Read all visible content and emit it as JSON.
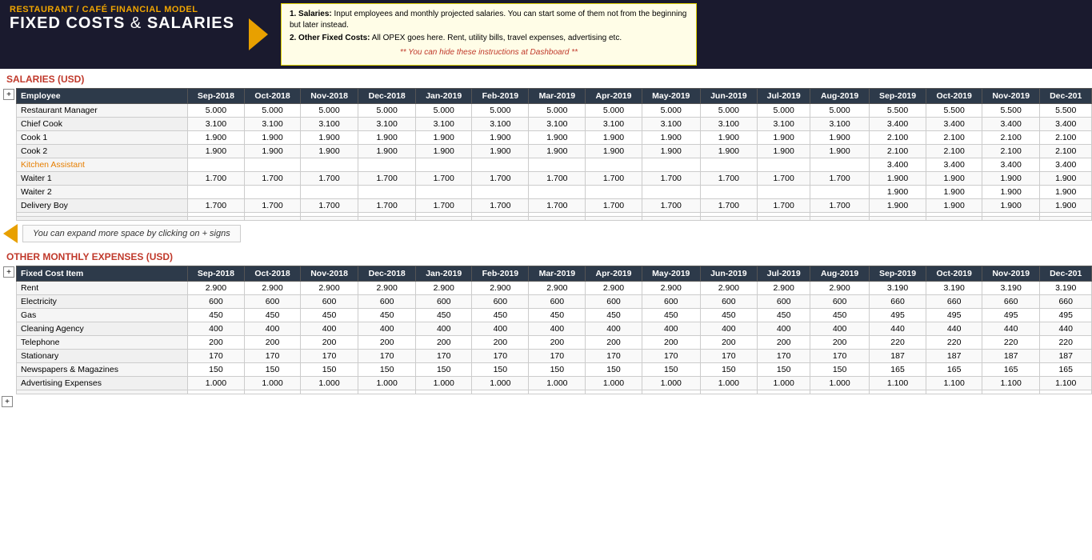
{
  "header": {
    "subtitle": "RESTAURANT / CAFÉ FINANCIAL MODEL",
    "title_main": "FIXED COSTS",
    "title_amp": " & ",
    "title_sub": "SALARIES",
    "info": {
      "point1_label": "1. Salaries:",
      "point1_text": " Input employees and monthly projected salaries. You can start some of them not from the beginning but later instead.",
      "point2_label": "2. Other Fixed Costs:",
      "point2_text": " All OPEX goes here. Rent, utility bills, travel expenses, advertising etc.",
      "note": "** You can hide these instructions at Dashboard **"
    }
  },
  "salaries_section": {
    "title": "SALARIES (USD)",
    "columns": [
      "Employee",
      "Sep-2018",
      "Oct-2018",
      "Nov-2018",
      "Dec-2018",
      "Jan-2019",
      "Feb-2019",
      "Mar-2019",
      "Apr-2019",
      "May-2019",
      "Jun-2019",
      "Jul-2019",
      "Aug-2019",
      "Sep-2019",
      "Oct-2019",
      "Nov-2019",
      "Dec-201"
    ],
    "rows": [
      {
        "name": "Restaurant Manager",
        "orange": false,
        "values": [
          "5.000",
          "5.000",
          "5.000",
          "5.000",
          "5.000",
          "5.000",
          "5.000",
          "5.000",
          "5.000",
          "5.000",
          "5.000",
          "5.000",
          "5.500",
          "5.500",
          "5.500",
          "5.500"
        ]
      },
      {
        "name": "Chief Cook",
        "orange": false,
        "values": [
          "3.100",
          "3.100",
          "3.100",
          "3.100",
          "3.100",
          "3.100",
          "3.100",
          "3.100",
          "3.100",
          "3.100",
          "3.100",
          "3.100",
          "3.400",
          "3.400",
          "3.400",
          "3.400"
        ]
      },
      {
        "name": "Cook 1",
        "orange": false,
        "values": [
          "1.900",
          "1.900",
          "1.900",
          "1.900",
          "1.900",
          "1.900",
          "1.900",
          "1.900",
          "1.900",
          "1.900",
          "1.900",
          "1.900",
          "2.100",
          "2.100",
          "2.100",
          "2.100"
        ]
      },
      {
        "name": "Cook 2",
        "orange": false,
        "values": [
          "1.900",
          "1.900",
          "1.900",
          "1.900",
          "1.900",
          "1.900",
          "1.900",
          "1.900",
          "1.900",
          "1.900",
          "1.900",
          "1.900",
          "2.100",
          "2.100",
          "2.100",
          "2.100"
        ]
      },
      {
        "name": "Kitchen Assistant",
        "orange": true,
        "values": [
          "",
          "",
          "",
          "",
          "",
          "",
          "",
          "",
          "",
          "",
          "",
          "",
          "3.400",
          "3.400",
          "3.400",
          "3.400"
        ]
      },
      {
        "name": "Waiter 1",
        "orange": false,
        "values": [
          "1.700",
          "1.700",
          "1.700",
          "1.700",
          "1.700",
          "1.700",
          "1.700",
          "1.700",
          "1.700",
          "1.700",
          "1.700",
          "1.700",
          "1.900",
          "1.900",
          "1.900",
          "1.900"
        ]
      },
      {
        "name": "Waiter 2",
        "orange": false,
        "values": [
          "",
          "",
          "",
          "",
          "",
          "",
          "",
          "",
          "",
          "",
          "",
          "",
          "1.900",
          "1.900",
          "1.900",
          "1.900"
        ]
      },
      {
        "name": "Delivery Boy",
        "orange": false,
        "values": [
          "1.700",
          "1.700",
          "1.700",
          "1.700",
          "1.700",
          "1.700",
          "1.700",
          "1.700",
          "1.700",
          "1.700",
          "1.700",
          "1.700",
          "1.900",
          "1.900",
          "1.900",
          "1.900"
        ]
      },
      {
        "name": "",
        "orange": false,
        "values": [
          "",
          "",
          "",
          "",
          "",
          "",
          "",
          "",
          "",
          "",
          "",
          "",
          "",
          "",
          "",
          ""
        ]
      },
      {
        "name": "",
        "orange": false,
        "values": [
          "",
          "",
          "",
          "",
          "",
          "",
          "",
          "",
          "",
          "",
          "",
          "",
          "",
          "",
          "",
          ""
        ]
      }
    ]
  },
  "expand_note": {
    "text": "You can expand more space by clicking on + signs"
  },
  "other_expenses_section": {
    "title": "OTHER MONTHLY EXPENSES (USD)",
    "columns": [
      "Fixed Cost Item",
      "Sep-2018",
      "Oct-2018",
      "Nov-2018",
      "Dec-2018",
      "Jan-2019",
      "Feb-2019",
      "Mar-2019",
      "Apr-2019",
      "May-2019",
      "Jun-2019",
      "Jul-2019",
      "Aug-2019",
      "Sep-2019",
      "Oct-2019",
      "Nov-2019",
      "Dec-201"
    ],
    "rows": [
      {
        "name": "Rent",
        "orange": false,
        "values": [
          "2.900",
          "2.900",
          "2.900",
          "2.900",
          "2.900",
          "2.900",
          "2.900",
          "2.900",
          "2.900",
          "2.900",
          "2.900",
          "2.900",
          "3.190",
          "3.190",
          "3.190",
          "3.190"
        ]
      },
      {
        "name": "Electricity",
        "orange": false,
        "values": [
          "600",
          "600",
          "600",
          "600",
          "600",
          "600",
          "600",
          "600",
          "600",
          "600",
          "600",
          "600",
          "660",
          "660",
          "660",
          "660"
        ]
      },
      {
        "name": "Gas",
        "orange": false,
        "values": [
          "450",
          "450",
          "450",
          "450",
          "450",
          "450",
          "450",
          "450",
          "450",
          "450",
          "450",
          "450",
          "495",
          "495",
          "495",
          "495"
        ]
      },
      {
        "name": "Cleaning Agency",
        "orange": false,
        "values": [
          "400",
          "400",
          "400",
          "400",
          "400",
          "400",
          "400",
          "400",
          "400",
          "400",
          "400",
          "400",
          "440",
          "440",
          "440",
          "440"
        ]
      },
      {
        "name": "Telephone",
        "orange": false,
        "values": [
          "200",
          "200",
          "200",
          "200",
          "200",
          "200",
          "200",
          "200",
          "200",
          "200",
          "200",
          "200",
          "220",
          "220",
          "220",
          "220"
        ]
      },
      {
        "name": "Stationary",
        "orange": false,
        "values": [
          "170",
          "170",
          "170",
          "170",
          "170",
          "170",
          "170",
          "170",
          "170",
          "170",
          "170",
          "170",
          "187",
          "187",
          "187",
          "187"
        ]
      },
      {
        "name": "Newspapers & Magazines",
        "orange": false,
        "values": [
          "150",
          "150",
          "150",
          "150",
          "150",
          "150",
          "150",
          "150",
          "150",
          "150",
          "150",
          "150",
          "165",
          "165",
          "165",
          "165"
        ]
      },
      {
        "name": "Advertising Expenses",
        "orange": false,
        "values": [
          "1.000",
          "1.000",
          "1.000",
          "1.000",
          "1.000",
          "1.000",
          "1.000",
          "1.000",
          "1.000",
          "1.000",
          "1.000",
          "1.000",
          "1.100",
          "1.100",
          "1.100",
          "1.100"
        ]
      },
      {
        "name": "",
        "orange": false,
        "values": [
          "",
          "",
          "",
          "",
          "",
          "",
          "",
          "",
          "",
          "",
          "",
          "",
          "",
          "",
          "",
          ""
        ]
      }
    ]
  },
  "plus_labels": {
    "salaries_plus": "+",
    "expenses_plus": "+"
  }
}
